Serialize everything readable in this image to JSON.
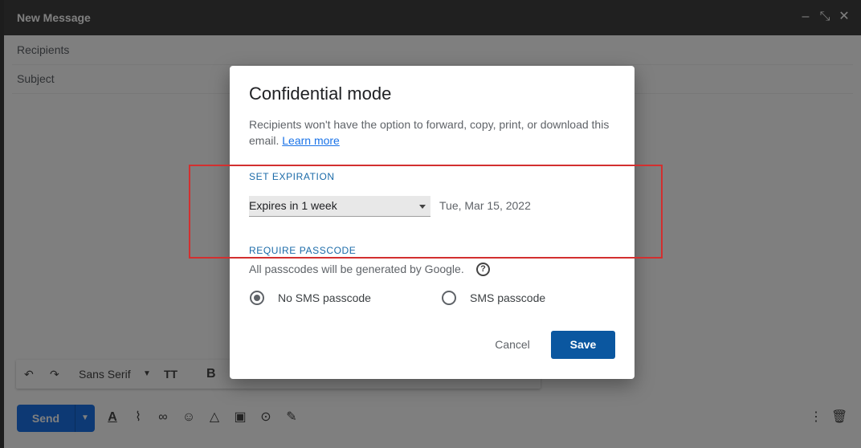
{
  "compose": {
    "title": "New Message",
    "recipients_placeholder": "Recipients",
    "subject_placeholder": "Subject",
    "toolbar": {
      "font": "Sans Serif"
    },
    "send_label": "Send"
  },
  "dialog": {
    "title": "Confidential mode",
    "description": "Recipients won't have the option to forward, copy, print, or download this email.",
    "learn_more": "Learn more",
    "expiration": {
      "heading": "SET EXPIRATION",
      "selected": "Expires in 1 week",
      "date": "Tue, Mar 15, 2022"
    },
    "passcode": {
      "heading": "REQUIRE PASSCODE",
      "note": "All passcodes will be generated by Google.",
      "options": [
        {
          "label": "No SMS passcode",
          "selected": true
        },
        {
          "label": "SMS passcode",
          "selected": false
        }
      ]
    },
    "cancel_label": "Cancel",
    "save_label": "Save"
  },
  "colors": {
    "save": "#0b57a0",
    "send": "#1a73e8",
    "section_heading": "#1a6aa8",
    "highlight_box": "#d32f2f"
  }
}
